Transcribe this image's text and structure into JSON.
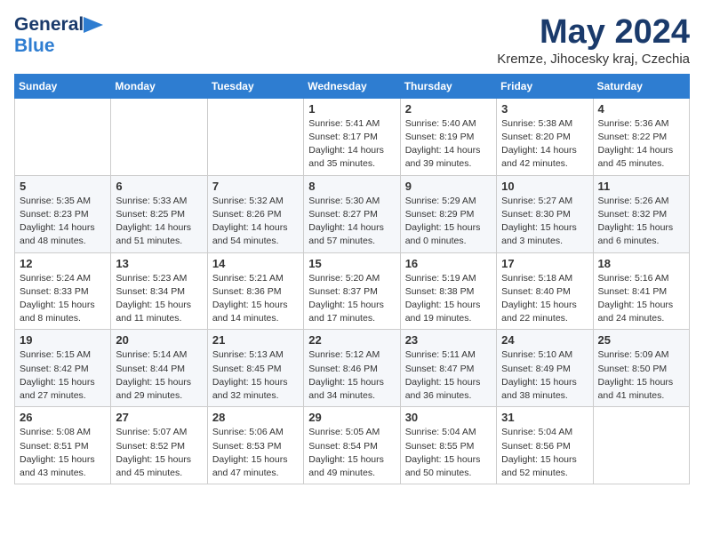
{
  "header": {
    "logo_general": "General",
    "logo_blue": "Blue",
    "month_title": "May 2024",
    "location": "Kremze, Jihocesky kraj, Czechia"
  },
  "days_of_week": [
    "Sunday",
    "Monday",
    "Tuesday",
    "Wednesday",
    "Thursday",
    "Friday",
    "Saturday"
  ],
  "weeks": [
    [
      {
        "day": "",
        "info": ""
      },
      {
        "day": "",
        "info": ""
      },
      {
        "day": "",
        "info": ""
      },
      {
        "day": "1",
        "info": "Sunrise: 5:41 AM\nSunset: 8:17 PM\nDaylight: 14 hours\nand 35 minutes."
      },
      {
        "day": "2",
        "info": "Sunrise: 5:40 AM\nSunset: 8:19 PM\nDaylight: 14 hours\nand 39 minutes."
      },
      {
        "day": "3",
        "info": "Sunrise: 5:38 AM\nSunset: 8:20 PM\nDaylight: 14 hours\nand 42 minutes."
      },
      {
        "day": "4",
        "info": "Sunrise: 5:36 AM\nSunset: 8:22 PM\nDaylight: 14 hours\nand 45 minutes."
      }
    ],
    [
      {
        "day": "5",
        "info": "Sunrise: 5:35 AM\nSunset: 8:23 PM\nDaylight: 14 hours\nand 48 minutes."
      },
      {
        "day": "6",
        "info": "Sunrise: 5:33 AM\nSunset: 8:25 PM\nDaylight: 14 hours\nand 51 minutes."
      },
      {
        "day": "7",
        "info": "Sunrise: 5:32 AM\nSunset: 8:26 PM\nDaylight: 14 hours\nand 54 minutes."
      },
      {
        "day": "8",
        "info": "Sunrise: 5:30 AM\nSunset: 8:27 PM\nDaylight: 14 hours\nand 57 minutes."
      },
      {
        "day": "9",
        "info": "Sunrise: 5:29 AM\nSunset: 8:29 PM\nDaylight: 15 hours\nand 0 minutes."
      },
      {
        "day": "10",
        "info": "Sunrise: 5:27 AM\nSunset: 8:30 PM\nDaylight: 15 hours\nand 3 minutes."
      },
      {
        "day": "11",
        "info": "Sunrise: 5:26 AM\nSunset: 8:32 PM\nDaylight: 15 hours\nand 6 minutes."
      }
    ],
    [
      {
        "day": "12",
        "info": "Sunrise: 5:24 AM\nSunset: 8:33 PM\nDaylight: 15 hours\nand 8 minutes."
      },
      {
        "day": "13",
        "info": "Sunrise: 5:23 AM\nSunset: 8:34 PM\nDaylight: 15 hours\nand 11 minutes."
      },
      {
        "day": "14",
        "info": "Sunrise: 5:21 AM\nSunset: 8:36 PM\nDaylight: 15 hours\nand 14 minutes."
      },
      {
        "day": "15",
        "info": "Sunrise: 5:20 AM\nSunset: 8:37 PM\nDaylight: 15 hours\nand 17 minutes."
      },
      {
        "day": "16",
        "info": "Sunrise: 5:19 AM\nSunset: 8:38 PM\nDaylight: 15 hours\nand 19 minutes."
      },
      {
        "day": "17",
        "info": "Sunrise: 5:18 AM\nSunset: 8:40 PM\nDaylight: 15 hours\nand 22 minutes."
      },
      {
        "day": "18",
        "info": "Sunrise: 5:16 AM\nSunset: 8:41 PM\nDaylight: 15 hours\nand 24 minutes."
      }
    ],
    [
      {
        "day": "19",
        "info": "Sunrise: 5:15 AM\nSunset: 8:42 PM\nDaylight: 15 hours\nand 27 minutes."
      },
      {
        "day": "20",
        "info": "Sunrise: 5:14 AM\nSunset: 8:44 PM\nDaylight: 15 hours\nand 29 minutes."
      },
      {
        "day": "21",
        "info": "Sunrise: 5:13 AM\nSunset: 8:45 PM\nDaylight: 15 hours\nand 32 minutes."
      },
      {
        "day": "22",
        "info": "Sunrise: 5:12 AM\nSunset: 8:46 PM\nDaylight: 15 hours\nand 34 minutes."
      },
      {
        "day": "23",
        "info": "Sunrise: 5:11 AM\nSunset: 8:47 PM\nDaylight: 15 hours\nand 36 minutes."
      },
      {
        "day": "24",
        "info": "Sunrise: 5:10 AM\nSunset: 8:49 PM\nDaylight: 15 hours\nand 38 minutes."
      },
      {
        "day": "25",
        "info": "Sunrise: 5:09 AM\nSunset: 8:50 PM\nDaylight: 15 hours\nand 41 minutes."
      }
    ],
    [
      {
        "day": "26",
        "info": "Sunrise: 5:08 AM\nSunset: 8:51 PM\nDaylight: 15 hours\nand 43 minutes."
      },
      {
        "day": "27",
        "info": "Sunrise: 5:07 AM\nSunset: 8:52 PM\nDaylight: 15 hours\nand 45 minutes."
      },
      {
        "day": "28",
        "info": "Sunrise: 5:06 AM\nSunset: 8:53 PM\nDaylight: 15 hours\nand 47 minutes."
      },
      {
        "day": "29",
        "info": "Sunrise: 5:05 AM\nSunset: 8:54 PM\nDaylight: 15 hours\nand 49 minutes."
      },
      {
        "day": "30",
        "info": "Sunrise: 5:04 AM\nSunset: 8:55 PM\nDaylight: 15 hours\nand 50 minutes."
      },
      {
        "day": "31",
        "info": "Sunrise: 5:04 AM\nSunset: 8:56 PM\nDaylight: 15 hours\nand 52 minutes."
      },
      {
        "day": "",
        "info": ""
      }
    ]
  ]
}
